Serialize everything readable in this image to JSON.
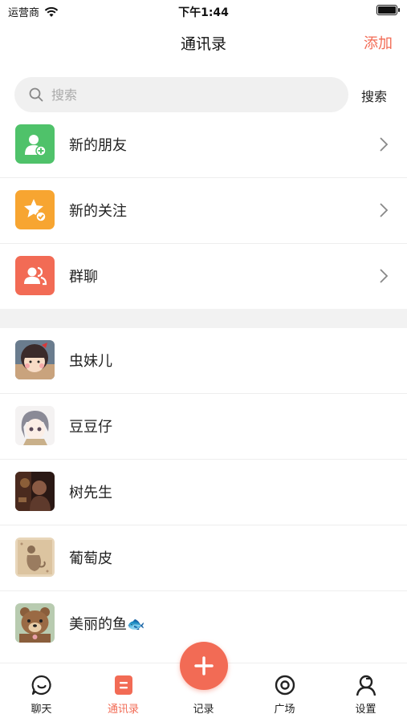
{
  "status_bar": {
    "carrier": "运营商",
    "time": "下午1:44"
  },
  "nav": {
    "title": "通讯录",
    "add_label": "添加"
  },
  "search": {
    "placeholder": "搜索",
    "button_label": "搜索"
  },
  "menu_items": [
    {
      "label": "新的朋友",
      "icon": "add-friend-icon",
      "color": "#4fc26a"
    },
    {
      "label": "新的关注",
      "icon": "star-follow-icon",
      "color": "#f7a531"
    },
    {
      "label": "群聊",
      "icon": "group-chat-icon",
      "color": "#f26b55"
    }
  ],
  "contacts": [
    {
      "name": "虫妹儿"
    },
    {
      "name": "豆豆仔"
    },
    {
      "name": "树先生"
    },
    {
      "name": "葡萄皮"
    },
    {
      "name": "美丽的鱼🐟"
    }
  ],
  "tabs": [
    {
      "label": "聊天",
      "icon": "chat-bubble-icon"
    },
    {
      "label": "通讯录",
      "icon": "contacts-icon",
      "active": true
    },
    {
      "label": "记录",
      "icon": "plus-icon"
    },
    {
      "label": "广场",
      "icon": "plaza-icon"
    },
    {
      "label": "设置",
      "icon": "profile-settings-icon"
    }
  ],
  "colors": {
    "accent": "#f26b55",
    "green": "#4fc26a",
    "orange": "#f7a531"
  }
}
